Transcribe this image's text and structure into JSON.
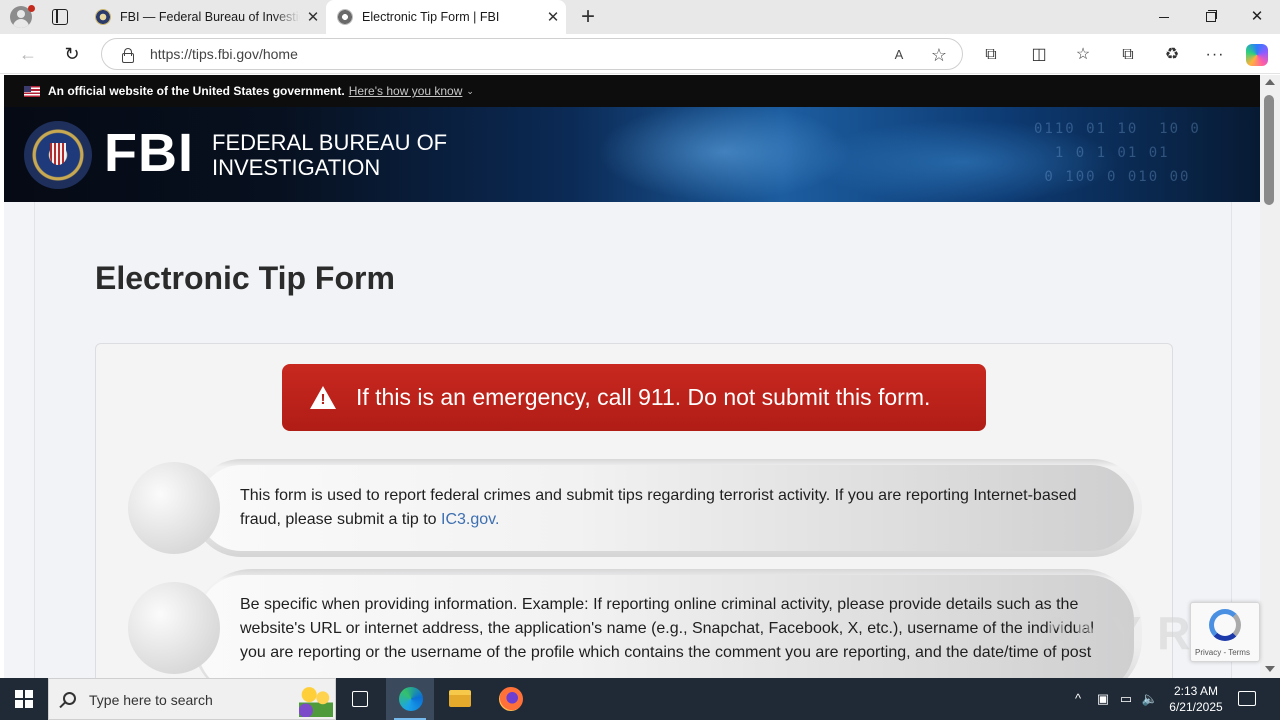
{
  "browser": {
    "tabs": [
      {
        "title": "FBI — Federal Bureau of Investigation",
        "active": false
      },
      {
        "title": "Electronic Tip Form | FBI",
        "active": true
      }
    ],
    "tab_close_glyph": "✕",
    "new_tab_glyph": "+",
    "url": "https://tips.fbi.gov/home",
    "icons": {
      "back": "←",
      "reload": "↻",
      "read_aloud": "A",
      "favorite": "☆",
      "extensions": "⧉",
      "split": "◫",
      "favorites": "☆",
      "collections": "⧉",
      "performance": "♻",
      "more": "···"
    }
  },
  "gov_banner": {
    "text": "An official website of the United States government.",
    "link": "Here's how you know",
    "chevron": "⌄"
  },
  "header": {
    "logo": "FBI",
    "name_line1": "FEDERAL BUREAU OF",
    "name_line2": "INVESTIGATION",
    "binary_art": "0110 01 10  10 0\n  1 0 1 01 01\n 0 100 0 010 00"
  },
  "page": {
    "title": "Electronic Tip Form",
    "alert": "If this is an emergency, call 911. Do not submit this form.",
    "info1_text": "This form is used to report federal crimes and submit tips regarding terrorist activity. If you are reporting Internet-based fraud, please submit a tip to ",
    "info1_link": "IC3.gov.",
    "info2_text": "Be specific when providing information. Example: If reporting online criminal activity, please provide details such as the website's URL or internet address, the application's name (e.g., Snapchat, Facebook, X, etc.), username of the individual you are reporting or the username of the profile which contains the comment you are reporting, and the date/time of post"
  },
  "recaptcha": {
    "links": "Privacy - Terms"
  },
  "watermark": "ANY RUN",
  "taskbar": {
    "search_placeholder": "Type here to search",
    "time": "2:13 AM",
    "date": "6/21/2025",
    "tray": {
      "chevron": "^",
      "meet": "▣",
      "network": "▭",
      "volume": "🔈"
    }
  },
  "colors": {
    "alert_red": "#b01d16",
    "link_blue": "#3d6fb0",
    "gov_bar": "#0d0d0d",
    "taskbar": "#1f2a36"
  }
}
